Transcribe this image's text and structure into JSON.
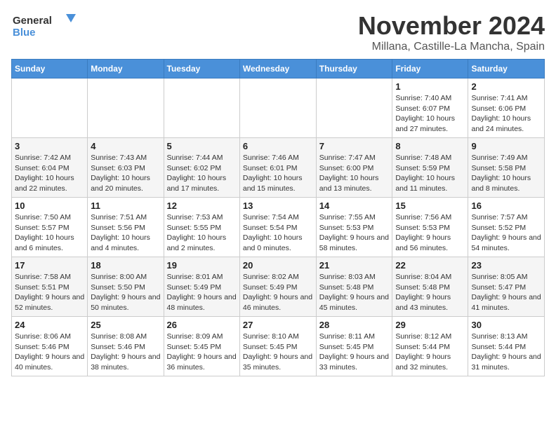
{
  "logo": {
    "general": "General",
    "blue": "Blue"
  },
  "title": "November 2024",
  "location": "Millana, Castille-La Mancha, Spain",
  "headers": [
    "Sunday",
    "Monday",
    "Tuesday",
    "Wednesday",
    "Thursday",
    "Friday",
    "Saturday"
  ],
  "weeks": [
    [
      {
        "day": "",
        "info": ""
      },
      {
        "day": "",
        "info": ""
      },
      {
        "day": "",
        "info": ""
      },
      {
        "day": "",
        "info": ""
      },
      {
        "day": "",
        "info": ""
      },
      {
        "day": "1",
        "info": "Sunrise: 7:40 AM\nSunset: 6:07 PM\nDaylight: 10 hours and 27 minutes."
      },
      {
        "day": "2",
        "info": "Sunrise: 7:41 AM\nSunset: 6:06 PM\nDaylight: 10 hours and 24 minutes."
      }
    ],
    [
      {
        "day": "3",
        "info": "Sunrise: 7:42 AM\nSunset: 6:04 PM\nDaylight: 10 hours and 22 minutes."
      },
      {
        "day": "4",
        "info": "Sunrise: 7:43 AM\nSunset: 6:03 PM\nDaylight: 10 hours and 20 minutes."
      },
      {
        "day": "5",
        "info": "Sunrise: 7:44 AM\nSunset: 6:02 PM\nDaylight: 10 hours and 17 minutes."
      },
      {
        "day": "6",
        "info": "Sunrise: 7:46 AM\nSunset: 6:01 PM\nDaylight: 10 hours and 15 minutes."
      },
      {
        "day": "7",
        "info": "Sunrise: 7:47 AM\nSunset: 6:00 PM\nDaylight: 10 hours and 13 minutes."
      },
      {
        "day": "8",
        "info": "Sunrise: 7:48 AM\nSunset: 5:59 PM\nDaylight: 10 hours and 11 minutes."
      },
      {
        "day": "9",
        "info": "Sunrise: 7:49 AM\nSunset: 5:58 PM\nDaylight: 10 hours and 8 minutes."
      }
    ],
    [
      {
        "day": "10",
        "info": "Sunrise: 7:50 AM\nSunset: 5:57 PM\nDaylight: 10 hours and 6 minutes."
      },
      {
        "day": "11",
        "info": "Sunrise: 7:51 AM\nSunset: 5:56 PM\nDaylight: 10 hours and 4 minutes."
      },
      {
        "day": "12",
        "info": "Sunrise: 7:53 AM\nSunset: 5:55 PM\nDaylight: 10 hours and 2 minutes."
      },
      {
        "day": "13",
        "info": "Sunrise: 7:54 AM\nSunset: 5:54 PM\nDaylight: 10 hours and 0 minutes."
      },
      {
        "day": "14",
        "info": "Sunrise: 7:55 AM\nSunset: 5:53 PM\nDaylight: 9 hours and 58 minutes."
      },
      {
        "day": "15",
        "info": "Sunrise: 7:56 AM\nSunset: 5:53 PM\nDaylight: 9 hours and 56 minutes."
      },
      {
        "day": "16",
        "info": "Sunrise: 7:57 AM\nSunset: 5:52 PM\nDaylight: 9 hours and 54 minutes."
      }
    ],
    [
      {
        "day": "17",
        "info": "Sunrise: 7:58 AM\nSunset: 5:51 PM\nDaylight: 9 hours and 52 minutes."
      },
      {
        "day": "18",
        "info": "Sunrise: 8:00 AM\nSunset: 5:50 PM\nDaylight: 9 hours and 50 minutes."
      },
      {
        "day": "19",
        "info": "Sunrise: 8:01 AM\nSunset: 5:49 PM\nDaylight: 9 hours and 48 minutes."
      },
      {
        "day": "20",
        "info": "Sunrise: 8:02 AM\nSunset: 5:49 PM\nDaylight: 9 hours and 46 minutes."
      },
      {
        "day": "21",
        "info": "Sunrise: 8:03 AM\nSunset: 5:48 PM\nDaylight: 9 hours and 45 minutes."
      },
      {
        "day": "22",
        "info": "Sunrise: 8:04 AM\nSunset: 5:48 PM\nDaylight: 9 hours and 43 minutes."
      },
      {
        "day": "23",
        "info": "Sunrise: 8:05 AM\nSunset: 5:47 PM\nDaylight: 9 hours and 41 minutes."
      }
    ],
    [
      {
        "day": "24",
        "info": "Sunrise: 8:06 AM\nSunset: 5:46 PM\nDaylight: 9 hours and 40 minutes."
      },
      {
        "day": "25",
        "info": "Sunrise: 8:08 AM\nSunset: 5:46 PM\nDaylight: 9 hours and 38 minutes."
      },
      {
        "day": "26",
        "info": "Sunrise: 8:09 AM\nSunset: 5:45 PM\nDaylight: 9 hours and 36 minutes."
      },
      {
        "day": "27",
        "info": "Sunrise: 8:10 AM\nSunset: 5:45 PM\nDaylight: 9 hours and 35 minutes."
      },
      {
        "day": "28",
        "info": "Sunrise: 8:11 AM\nSunset: 5:45 PM\nDaylight: 9 hours and 33 minutes."
      },
      {
        "day": "29",
        "info": "Sunrise: 8:12 AM\nSunset: 5:44 PM\nDaylight: 9 hours and 32 minutes."
      },
      {
        "day": "30",
        "info": "Sunrise: 8:13 AM\nSunset: 5:44 PM\nDaylight: 9 hours and 31 minutes."
      }
    ]
  ]
}
